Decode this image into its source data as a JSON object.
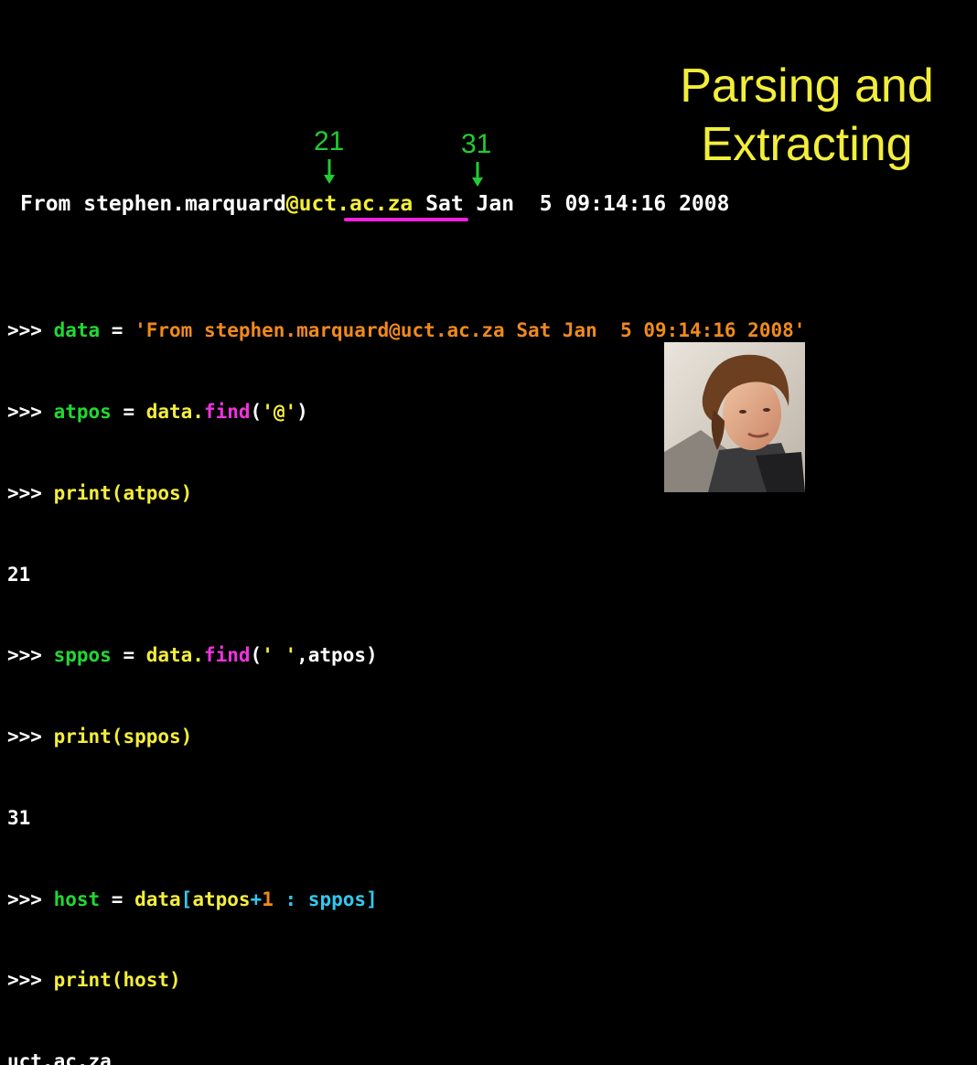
{
  "title": {
    "line1": "Parsing and",
    "line2": "Extracting"
  },
  "markers": {
    "at_index": "21",
    "space_index": "31"
  },
  "email_line": {
    "before": "From stephen.marquard",
    "at": "@",
    "host": "uct.ac.za",
    "after": " Sat Jan  5 09:14:16 2008"
  },
  "code": {
    "prompt": ">>> ",
    "l1_var": "data",
    "l1_eq": " = ",
    "l1_str": "'From stephen.marquard@uct.ac.za Sat Jan  5 09:14:16 2008'",
    "l2_var": "atpos",
    "l2_eq": " = ",
    "l2_obj": "data.",
    "l2_fn": "find",
    "l2_open": "(",
    "l2_str": "'@'",
    "l2_close": ")",
    "l3_fn": "print",
    "l3_arg": "(atpos)",
    "l4_out": "21",
    "l5_var": "sppos",
    "l5_eq": " = ",
    "l5_obj": "data.",
    "l5_fn": "find",
    "l5_open": "(",
    "l5_str": "' '",
    "l5_rest": ",atpos)",
    "l6_fn": "print",
    "l6_arg": "(sppos)",
    "l7_out": "31",
    "l8_var": "host",
    "l8_eq": " = ",
    "l8_obj": "data",
    "l8_b1": "[",
    "l8_a": "atpos",
    "l8_plus": "+",
    "l8_one": "1",
    "l8_colon": " : ",
    "l8_b": "sppos",
    "l8_b2": "]",
    "l9_fn": "print",
    "l9_arg": "(host)",
    "l10_out": "uct.ac.za"
  }
}
